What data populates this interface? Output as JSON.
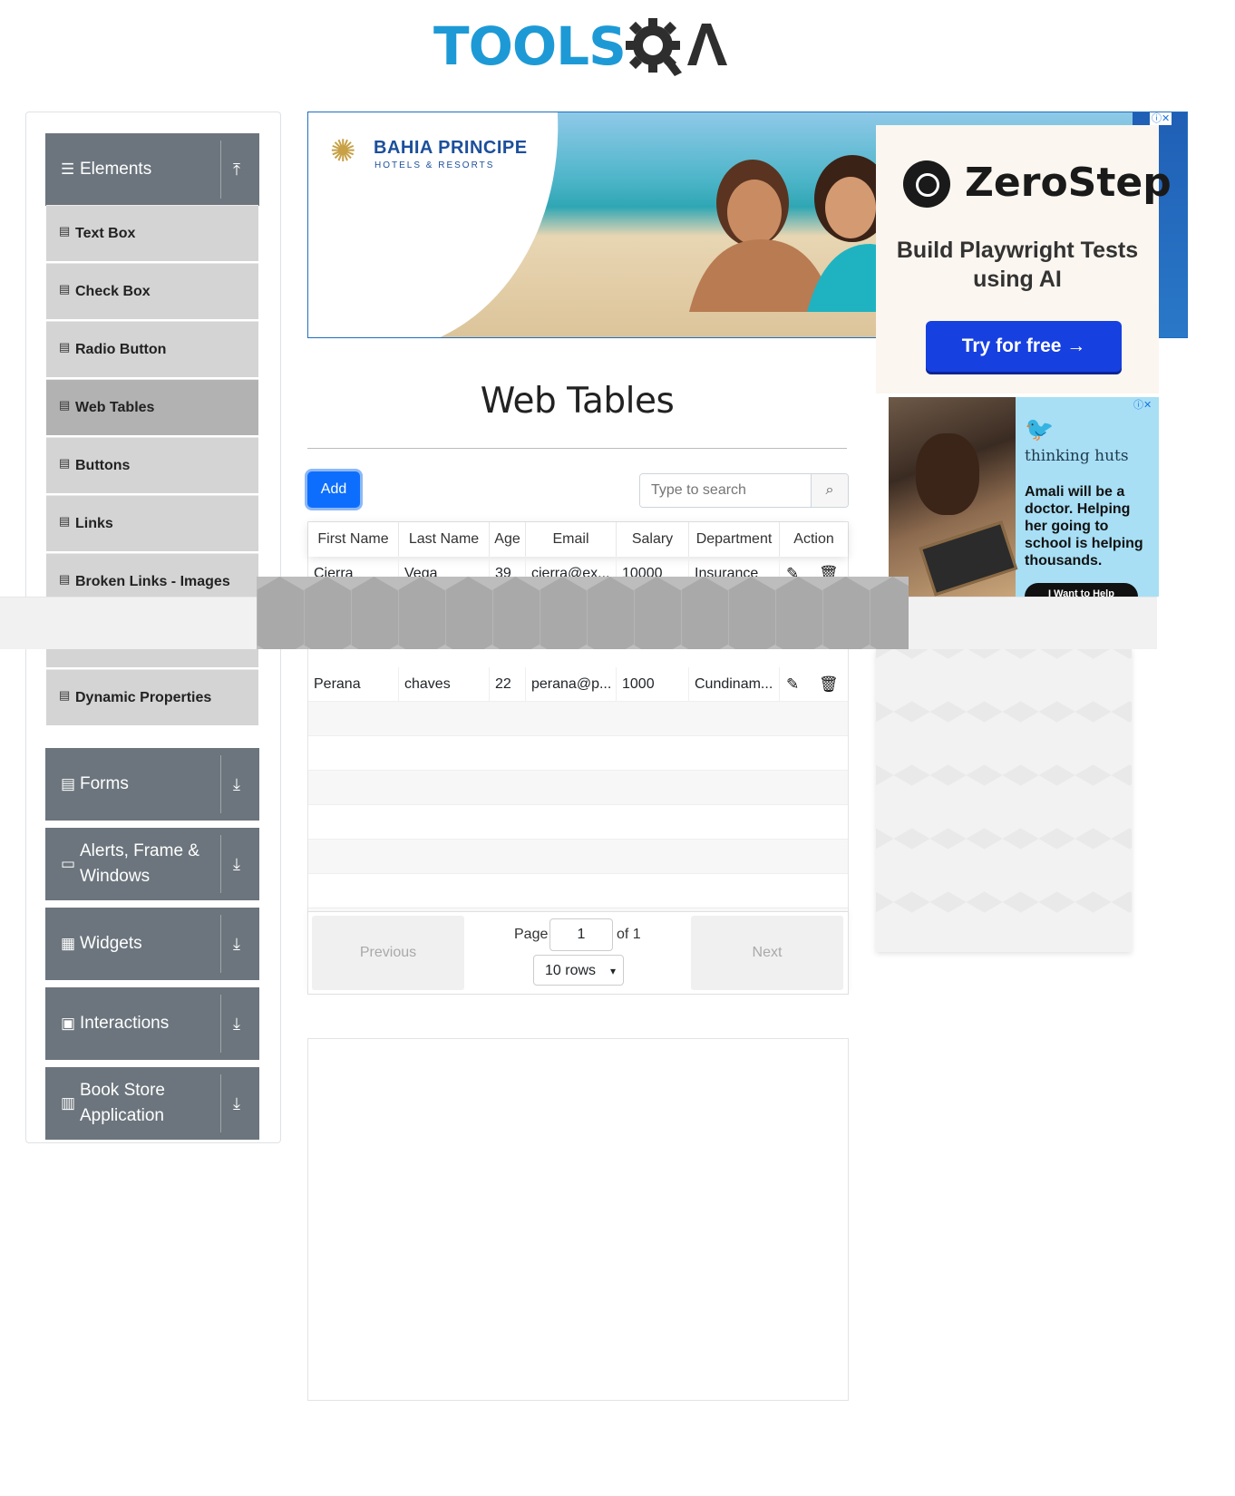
{
  "brand": {
    "logo_text": "TOOLSQA",
    "logo_part1": "TOOLS"
  },
  "colors": {
    "primary": "#0d6efd",
    "sidebar_header": "#6c757d",
    "menu_item": "#d4d4d4",
    "menu_active": "#b2b2b2",
    "logo_blue": "#1d9ad6"
  },
  "sidebar": {
    "elements_group": {
      "label": "Elements",
      "icon": "hamburger-icon",
      "arrow": "collapse-up-icon"
    },
    "items": [
      {
        "label": "Text Box"
      },
      {
        "label": "Check Box"
      },
      {
        "label": "Radio Button"
      },
      {
        "label": "Web Tables"
      },
      {
        "label": "Buttons"
      },
      {
        "label": "Links"
      },
      {
        "label": "Broken Links - Images"
      },
      {
        "label": "Dynamic Properties"
      }
    ],
    "groups": [
      {
        "label": "Forms",
        "icon": "form-icon"
      },
      {
        "label": "Alerts, Frame & Windows",
        "icon": "window-icon"
      },
      {
        "label": "Widgets",
        "icon": "widgets-icon"
      },
      {
        "label": "Interactions",
        "icon": "interactions-icon"
      },
      {
        "label": "Book Store Application",
        "icon": "bookstore-icon"
      }
    ]
  },
  "ads": {
    "banner": {
      "brand": "BAHIA PRINCIPE",
      "sub": "HOTELS & RESORTS"
    },
    "zerostep": {
      "title": "ZeroStep",
      "subtitle": "Build Playwright Tests using AI",
      "cta": "Try for free →"
    },
    "huts": {
      "brand": "thinking huts",
      "text": "Amali will be a doctor. Helping her going to school is helping thousands.",
      "cta": "I Want to Help"
    }
  },
  "main": {
    "title": "Web Tables",
    "add_label": "Add",
    "search_placeholder": "Type to search",
    "columns": [
      "First Name",
      "Last Name",
      "Age",
      "Email",
      "Salary",
      "Department",
      "Action"
    ],
    "rows": [
      {
        "first": "Cierra",
        "last": "Vega",
        "age": "39",
        "email": "cierra@ex...",
        "salary": "10000",
        "dept": "Insurance"
      },
      {
        "first": "Perana",
        "last": "chaves",
        "age": "22",
        "email": "perana@p...",
        "salary": "1000",
        "dept": "Cundinam..."
      }
    ],
    "pagination": {
      "previous": "Previous",
      "next": "Next",
      "page_label": "Page",
      "page_value": "1",
      "of_label": "of 1",
      "rows_select": "10 rows"
    }
  }
}
